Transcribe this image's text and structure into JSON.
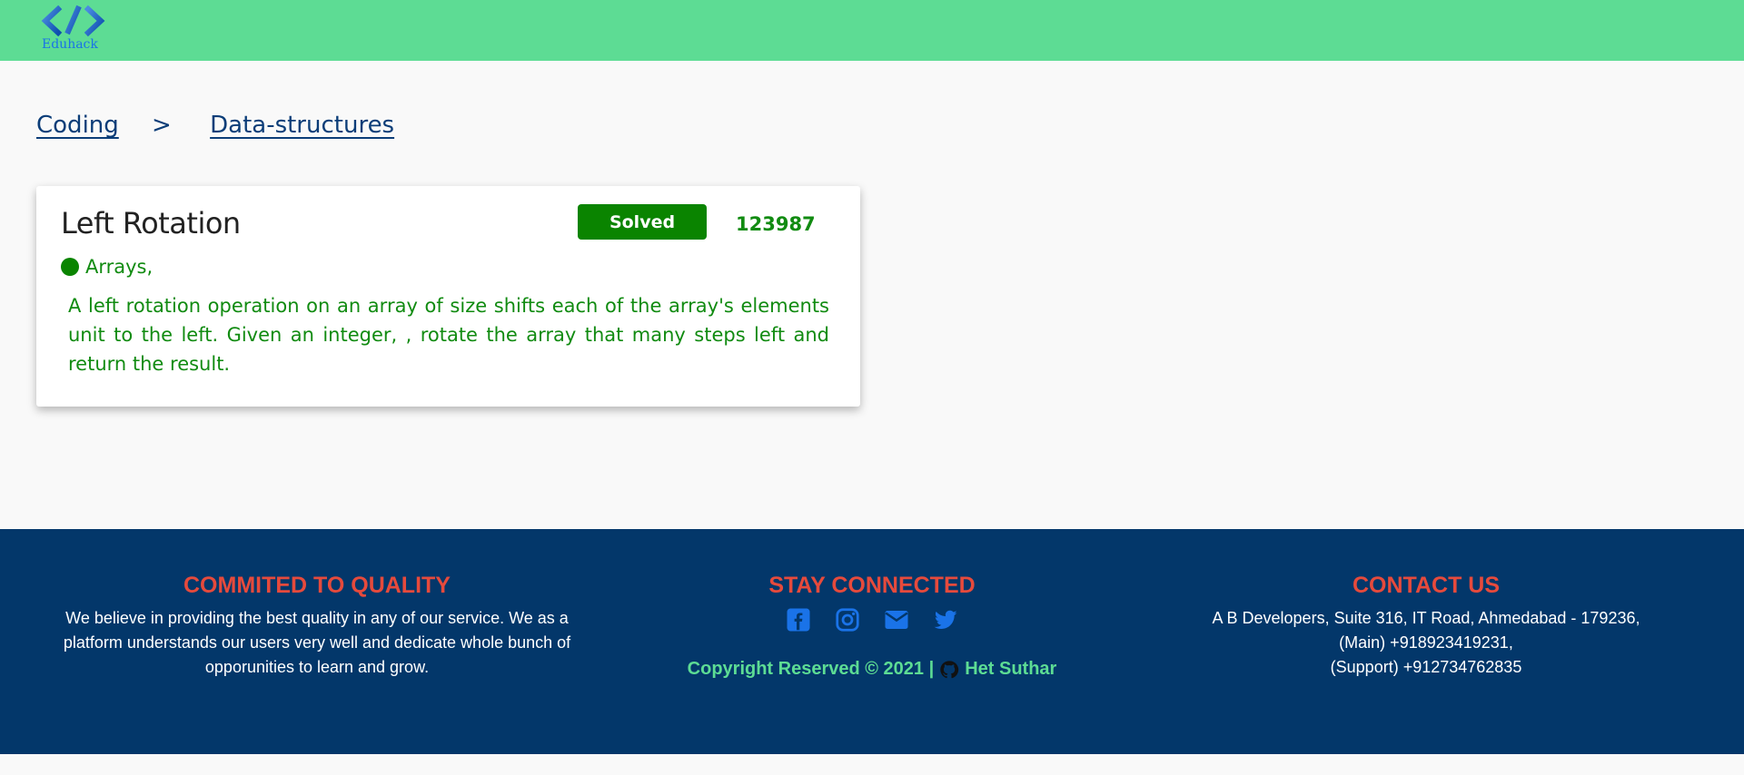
{
  "header": {
    "logo_text": "Eduhack",
    "brand_color": "#5ddc94"
  },
  "breadcrumb": {
    "items": [
      "Coding",
      "Data-structures"
    ],
    "separator": ">"
  },
  "question": {
    "title": "Left Rotation",
    "status": "Solved",
    "count": "123987",
    "tag": "Arrays,",
    "description": "A left rotation operation on an array of size shifts each of the array's elements unit to the left. Given an integer, , rotate the array that many steps left and return the result."
  },
  "footer": {
    "quality": {
      "heading": "COMMITED TO QUALITY",
      "text": "We believe in providing the best quality in any of our service. We as a platform understands our users very well and dedicate whole bunch of opporunities to learn and grow."
    },
    "connect": {
      "heading": "STAY CONNECTED",
      "icons": [
        "facebook-icon",
        "instagram-icon",
        "mail-icon",
        "twitter-icon"
      ],
      "copyright": "Copyright Reserved © 2021 |",
      "author": "Het Suthar"
    },
    "contact": {
      "heading": "CONTACT US",
      "address": "A B Developers, Suite 316, IT Road, Ahmedabad - 179236,",
      "main_phone": "(Main) +918923419231,",
      "support_phone": "(Support) +912734762835"
    },
    "background": "#03376a",
    "heading_color": "#e64a3c"
  }
}
